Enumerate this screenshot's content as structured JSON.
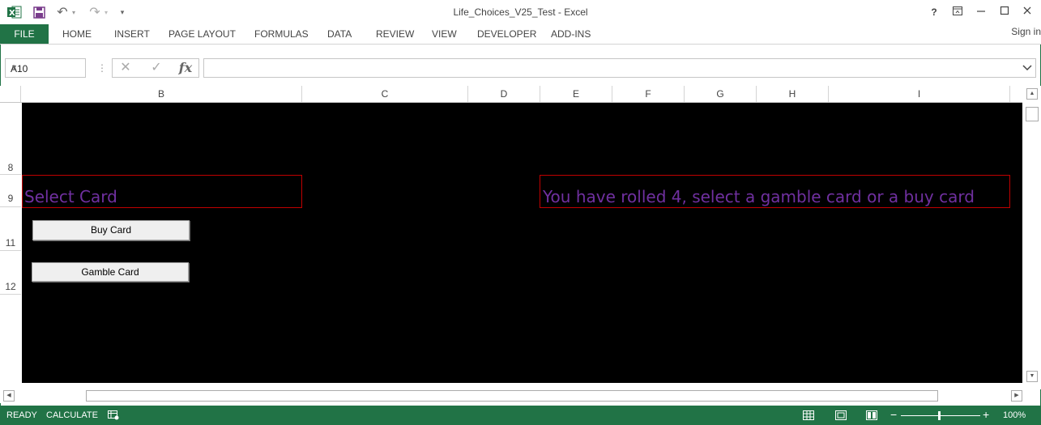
{
  "window": {
    "title": "Life_Choices_V25_Test - Excel",
    "help": "?",
    "undo": "↶",
    "redo": "↷",
    "customize": "⩡"
  },
  "ribbon": {
    "file": "FILE",
    "tabs": [
      "HOME",
      "INSERT",
      "PAGE LAYOUT",
      "FORMULAS",
      "DATA",
      "REVIEW",
      "VIEW",
      "DEVELOPER",
      "ADD-INS"
    ],
    "sign_in": "Sign in"
  },
  "formula_bar": {
    "name_box": "A10",
    "cancel": "✕",
    "enter": "✓",
    "fx": "fx",
    "value": ""
  },
  "columns": [
    "B",
    "C",
    "D",
    "E",
    "F",
    "G",
    "H",
    "I"
  ],
  "rows": [
    "8",
    "9",
    "11",
    "12"
  ],
  "sheet": {
    "select_label": "Select Card",
    "roll_message": "You have rolled 4, select a gamble card or a buy card",
    "buy_button": "Buy Card",
    "gamble_button": "Gamble Card",
    "background": "#000000",
    "text_color": "#7030A0",
    "border_color": "#C00000"
  },
  "status": {
    "ready": "READY",
    "calculate": "CALCULATE",
    "zoom": "100%",
    "zoom_out": "−",
    "zoom_in": "+"
  },
  "colors": {
    "accent": "#217346"
  }
}
